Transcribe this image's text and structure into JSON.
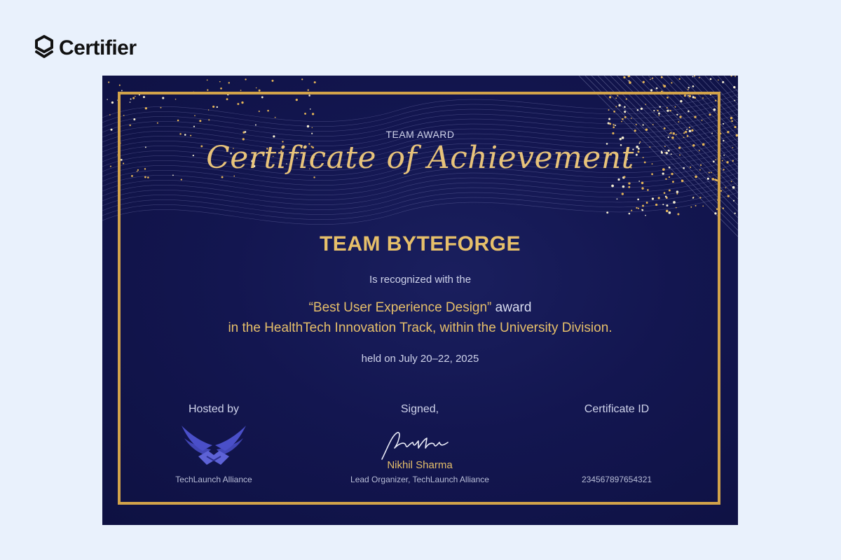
{
  "brand": {
    "name": "Certifier",
    "icon": "shield-chevron-icon"
  },
  "certificate": {
    "kicker": "TEAM AWARD",
    "title": "Certificate of Achievement",
    "recipient": "TEAM BYTEFORGE",
    "intro": "Is recognized with the",
    "award_name": "“Best User Experience Design”",
    "award_suffix": " award",
    "award_context": "in the HealthTech Innovation Track, within the University Division.",
    "held": "held on July 20–22, 2025",
    "hosted": {
      "label": "Hosted by",
      "org": "TechLaunch Alliance",
      "logo_icon": "winged-handshake-icon"
    },
    "signed": {
      "label": "Signed,",
      "name": "Nikhil Sharma",
      "role": "Lead Organizer, TechLaunch Alliance"
    },
    "id_block": {
      "label": "Certificate ID",
      "value": "234567897654321"
    }
  },
  "colors": {
    "page_background": "#e9f1fc",
    "certificate_background": "#131650",
    "gold": "#d2a34a",
    "gold_text": "#e6bf6a",
    "muted_text": "#cfd3ea",
    "logo_purple": "#4a4fc9"
  }
}
